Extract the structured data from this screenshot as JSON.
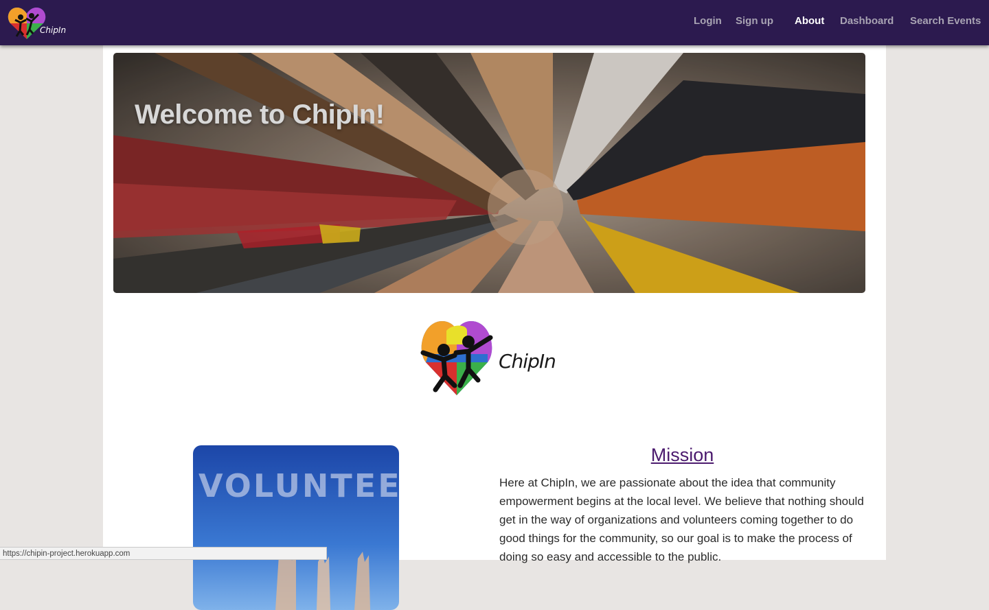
{
  "navbar": {
    "brand_text": "ChipIn",
    "links": [
      {
        "label": "Login",
        "active": false
      },
      {
        "label": "Sign up",
        "active": false
      },
      {
        "label": "About",
        "active": true
      },
      {
        "label": "Dashboard",
        "active": false
      },
      {
        "label": "Search Events",
        "active": false
      }
    ]
  },
  "hero": {
    "title": "Welcome to ChipIn!",
    "image": "hands-joined-circle-photo"
  },
  "logo": {
    "text": "ChipIn",
    "icon": "puzzle-heart-logo"
  },
  "volunteer_image": {
    "text": "VOLUNTEER"
  },
  "mission": {
    "heading": "Mission",
    "body": "Here at ChipIn, we are passionate about the idea that community empowerment begins at the local level. We believe that nothing should get in the way of organizations and volunteers coming together to do good things for the community, so our goal is to make the process of doing so easy and accessible to the public."
  },
  "status_bar": {
    "url": "https://chipin-project.herokuapp.com"
  },
  "colors": {
    "navbar": "#2c1a4f",
    "nav_inactive": "#a8a3b3",
    "nav_active": "#ffffff",
    "mission_heading": "#4b1a6e",
    "page_bg": "#e8e5e3"
  }
}
